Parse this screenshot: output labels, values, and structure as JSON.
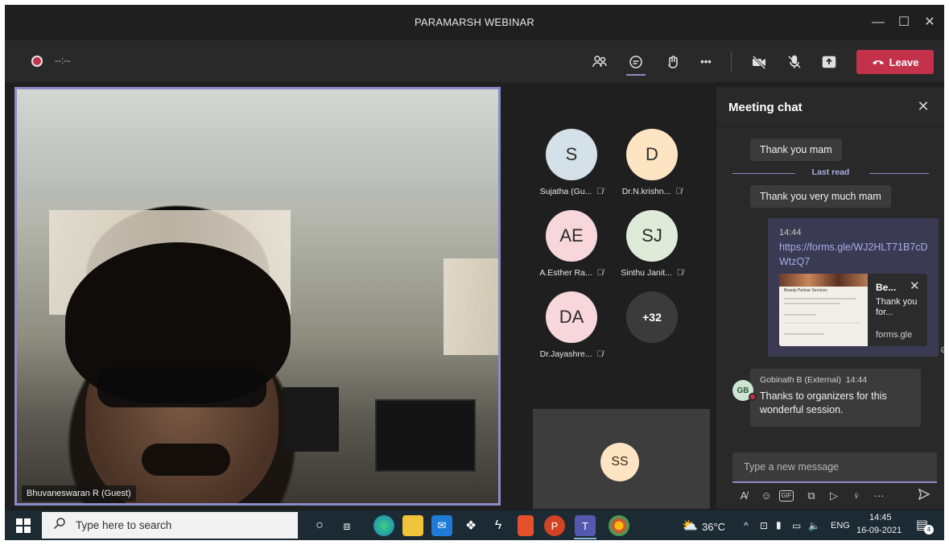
{
  "window": {
    "title": "PARAMARSH WEBINAR",
    "controls": {
      "minimize": "—",
      "maximize": "☐",
      "close": "✕"
    }
  },
  "toolbar": {
    "timer": "--:--",
    "people_icon": "people-icon",
    "chat_icon": "chat-icon",
    "reactions_icon": "reactions-icon",
    "more_label": "•••",
    "camera_icon": "camera-off-icon",
    "mic_icon": "mic-off-icon",
    "share_icon": "share-icon",
    "leave_label": "Leave",
    "leave_color": "#c4314b"
  },
  "main_video": {
    "participant_name": "Bhuvaneswaran R (Guest)",
    "border_color": "#8b8cc7"
  },
  "participants": [
    {
      "initials": "S",
      "name": "Sujatha (Gu...",
      "color": "#d4e1e8"
    },
    {
      "initials": "D",
      "name": "Dr.N.krishn...",
      "color": "#fde4c2"
    },
    {
      "initials": "AE",
      "name": "A.Esther Ra...",
      "color": "#f7d7dc"
    },
    {
      "initials": "SJ",
      "name": "Sinthu Janit...",
      "color": "#dfead9"
    },
    {
      "initials": "DA",
      "name": "Dr.Jayashre...",
      "color": "#f7d7dc"
    }
  ],
  "more_participants": "+32",
  "self_tile": {
    "initials": "SS"
  },
  "chat": {
    "title": "Meeting chat",
    "messages": [
      {
        "text": "Thank you mam"
      },
      {
        "text": "Thank you very much mam"
      }
    ],
    "last_read_label": "Last read",
    "link_message": {
      "time": "14:44",
      "link": "https://forms.gle/WJ2HLT71B7cDWtzQ7",
      "preview": {
        "image_title": "Beauty Parlour Services",
        "title": "Be...",
        "description": "Thank you for...",
        "domain": "forms.gle"
      }
    },
    "reply": {
      "avatar": "GB",
      "author": "Gobinath B (External)",
      "time": "14:44",
      "text": "Thanks to organizers for this wonderful session."
    },
    "compose_placeholder": "Type a new message",
    "gif_label": "GIF",
    "more_label": "···"
  },
  "taskbar": {
    "search_placeholder": "Type here to search",
    "temperature": "36°C",
    "language": "ENG",
    "time": "14:45",
    "date": "16-09-2021",
    "notifications": "4"
  }
}
